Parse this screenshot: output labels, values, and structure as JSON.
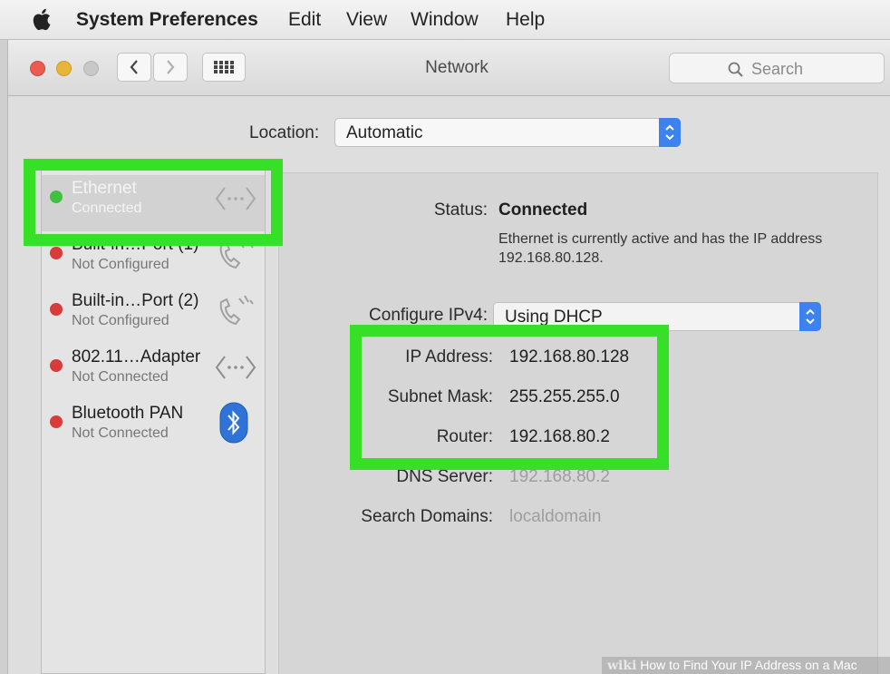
{
  "menubar": {
    "app_name": "System Preferences",
    "items": [
      "Edit",
      "View",
      "Window",
      "Help"
    ]
  },
  "window": {
    "title": "Network",
    "search_placeholder": "Search",
    "traffic_lights": {
      "close": "#ec5b4f",
      "minimize": "#e6b53a",
      "zoom": "#c8c8c8"
    }
  },
  "location": {
    "label": "Location:",
    "value": "Automatic"
  },
  "services": [
    {
      "name": "Ethernet",
      "status": "Connected",
      "status_color": "#3fc03f",
      "icon": "ethernet-arrows-icon",
      "selected": true
    },
    {
      "name": "Built-in…Port (1)",
      "status": "Not Configured",
      "status_color": "#d93a3a",
      "icon": "phone-modem-icon"
    },
    {
      "name": "Built-in…Port (2)",
      "status": "Not Configured",
      "status_color": "#d93a3a",
      "icon": "phone-modem-icon"
    },
    {
      "name": "802.11…Adapter",
      "status": "Not Connected",
      "status_color": "#d93a3a",
      "icon": "ethernet-arrows-icon"
    },
    {
      "name": "Bluetooth PAN",
      "status": "Not Connected",
      "status_color": "#d93a3a",
      "icon": "bluetooth-icon"
    }
  ],
  "details": {
    "status_label": "Status:",
    "status_value": "Connected",
    "status_description": "Ethernet is currently active and has the IP address 192.168.80.128.",
    "configure_label": "Configure IPv4:",
    "configure_value": "Using DHCP",
    "ip_label": "IP Address:",
    "ip_value": "192.168.80.128",
    "subnet_label": "Subnet Mask:",
    "subnet_value": "255.255.255.0",
    "router_label": "Router:",
    "router_value": "192.168.80.2",
    "dns_label": "DNS Server:",
    "dns_value": "192.168.80.2",
    "domains_label": "Search Domains:",
    "domains_value": "localdomain"
  },
  "highlight_color": "#35e026",
  "watermark": {
    "brand": "wiki",
    "text": "How to Find Your IP Address on a Mac"
  }
}
